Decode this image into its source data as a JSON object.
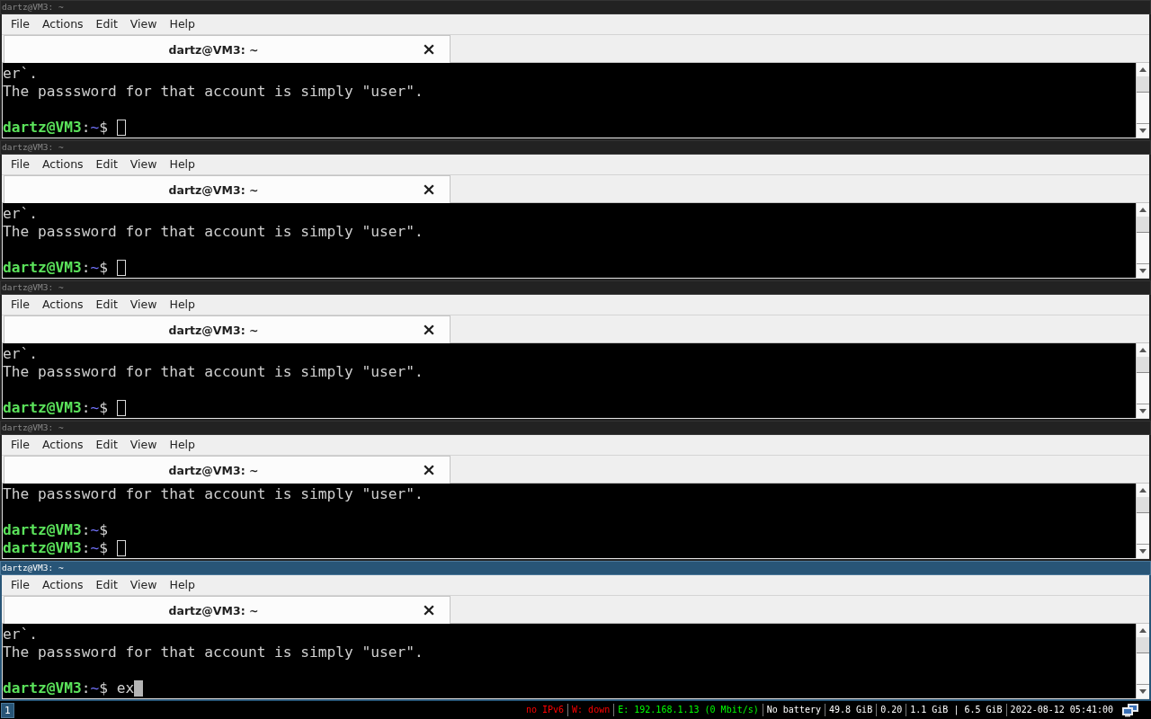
{
  "windows": [
    {
      "title": "dartz@VM3: ~",
      "focused": false,
      "menu": [
        "File",
        "Actions",
        "Edit",
        "View",
        "Help"
      ],
      "tab": {
        "label": "dartz@VM3: ~",
        "selected": true
      },
      "lines": [
        {
          "kind": "output",
          "text": "er`."
        },
        {
          "kind": "output",
          "text": "The passsword for that account is simply \"user\"."
        },
        {
          "kind": "blank"
        },
        {
          "kind": "prompt",
          "user": "dartz@VM3",
          "separator": ":",
          "path": "~",
          "symbol": "$",
          "cursor": true
        }
      ]
    },
    {
      "title": "dartz@VM3: ~",
      "focused": false,
      "menu": [
        "File",
        "Actions",
        "Edit",
        "View",
        "Help"
      ],
      "tab": {
        "label": "dartz@VM3: ~",
        "selected": true
      },
      "lines": [
        {
          "kind": "output",
          "text": "er`."
        },
        {
          "kind": "output",
          "text": "The passsword for that account is simply \"user\"."
        },
        {
          "kind": "blank"
        },
        {
          "kind": "prompt",
          "user": "dartz@VM3",
          "separator": ":",
          "path": "~",
          "symbol": "$",
          "cursor": true
        }
      ]
    },
    {
      "title": "dartz@VM3: ~",
      "focused": false,
      "menu": [
        "File",
        "Actions",
        "Edit",
        "View",
        "Help"
      ],
      "tab": {
        "label": "dartz@VM3: ~",
        "selected": true
      },
      "lines": [
        {
          "kind": "output",
          "text": "er`."
        },
        {
          "kind": "output",
          "text": "The passsword for that account is simply \"user\"."
        },
        {
          "kind": "blank"
        },
        {
          "kind": "prompt",
          "user": "dartz@VM3",
          "separator": ":",
          "path": "~",
          "symbol": "$",
          "cursor": true
        }
      ]
    },
    {
      "title": "dartz@VM3: ~",
      "focused": false,
      "menu": [
        "File",
        "Actions",
        "Edit",
        "View",
        "Help"
      ],
      "tab": {
        "label": "dartz@VM3: ~",
        "selected": true
      },
      "lines": [
        {
          "kind": "output",
          "text": "The passsword for that account is simply \"user\"."
        },
        {
          "kind": "blank"
        },
        {
          "kind": "prompt",
          "user": "dartz@VM3",
          "separator": ":",
          "path": "~",
          "symbol": "$",
          "cursor": false
        },
        {
          "kind": "prompt",
          "user": "dartz@VM3",
          "separator": ":",
          "path": "~",
          "symbol": "$",
          "cursor": true
        }
      ]
    },
    {
      "title": "dartz@VM3: ~",
      "focused": true,
      "menu": [
        "File",
        "Actions",
        "Edit",
        "View",
        "Help"
      ],
      "tab": {
        "label": "dartz@VM3: ~",
        "selected": true
      },
      "lines": [
        {
          "kind": "output",
          "text": "er`."
        },
        {
          "kind": "output",
          "text": "The passsword for that account is simply \"user\"."
        },
        {
          "kind": "blank"
        },
        {
          "kind": "prompt",
          "user": "dartz@VM3",
          "separator": ":",
          "path": "~",
          "symbol": "$",
          "input": "ex",
          "cursor": true
        }
      ]
    }
  ],
  "status_bar": {
    "workspaces": [
      {
        "label": "1",
        "selected": true
      }
    ],
    "items": [
      {
        "text": "no IPv6",
        "color": "#ff0000"
      },
      {
        "text": "W: down",
        "color": "#ff0000"
      },
      {
        "text": "E: 192.168.1.13 (0 Mbit/s)",
        "color": "#00ff00"
      },
      {
        "text": "No battery",
        "color": "#ffffff"
      },
      {
        "text": "49.8 GiB",
        "color": "#ffffff"
      },
      {
        "text": "0.20",
        "color": "#ffffff"
      },
      {
        "text": "1.1 GiB | 6.5 GiB",
        "color": "#ffffff"
      },
      {
        "text": "2022-08-12 05:41:00",
        "color": "#ffffff"
      }
    ]
  }
}
